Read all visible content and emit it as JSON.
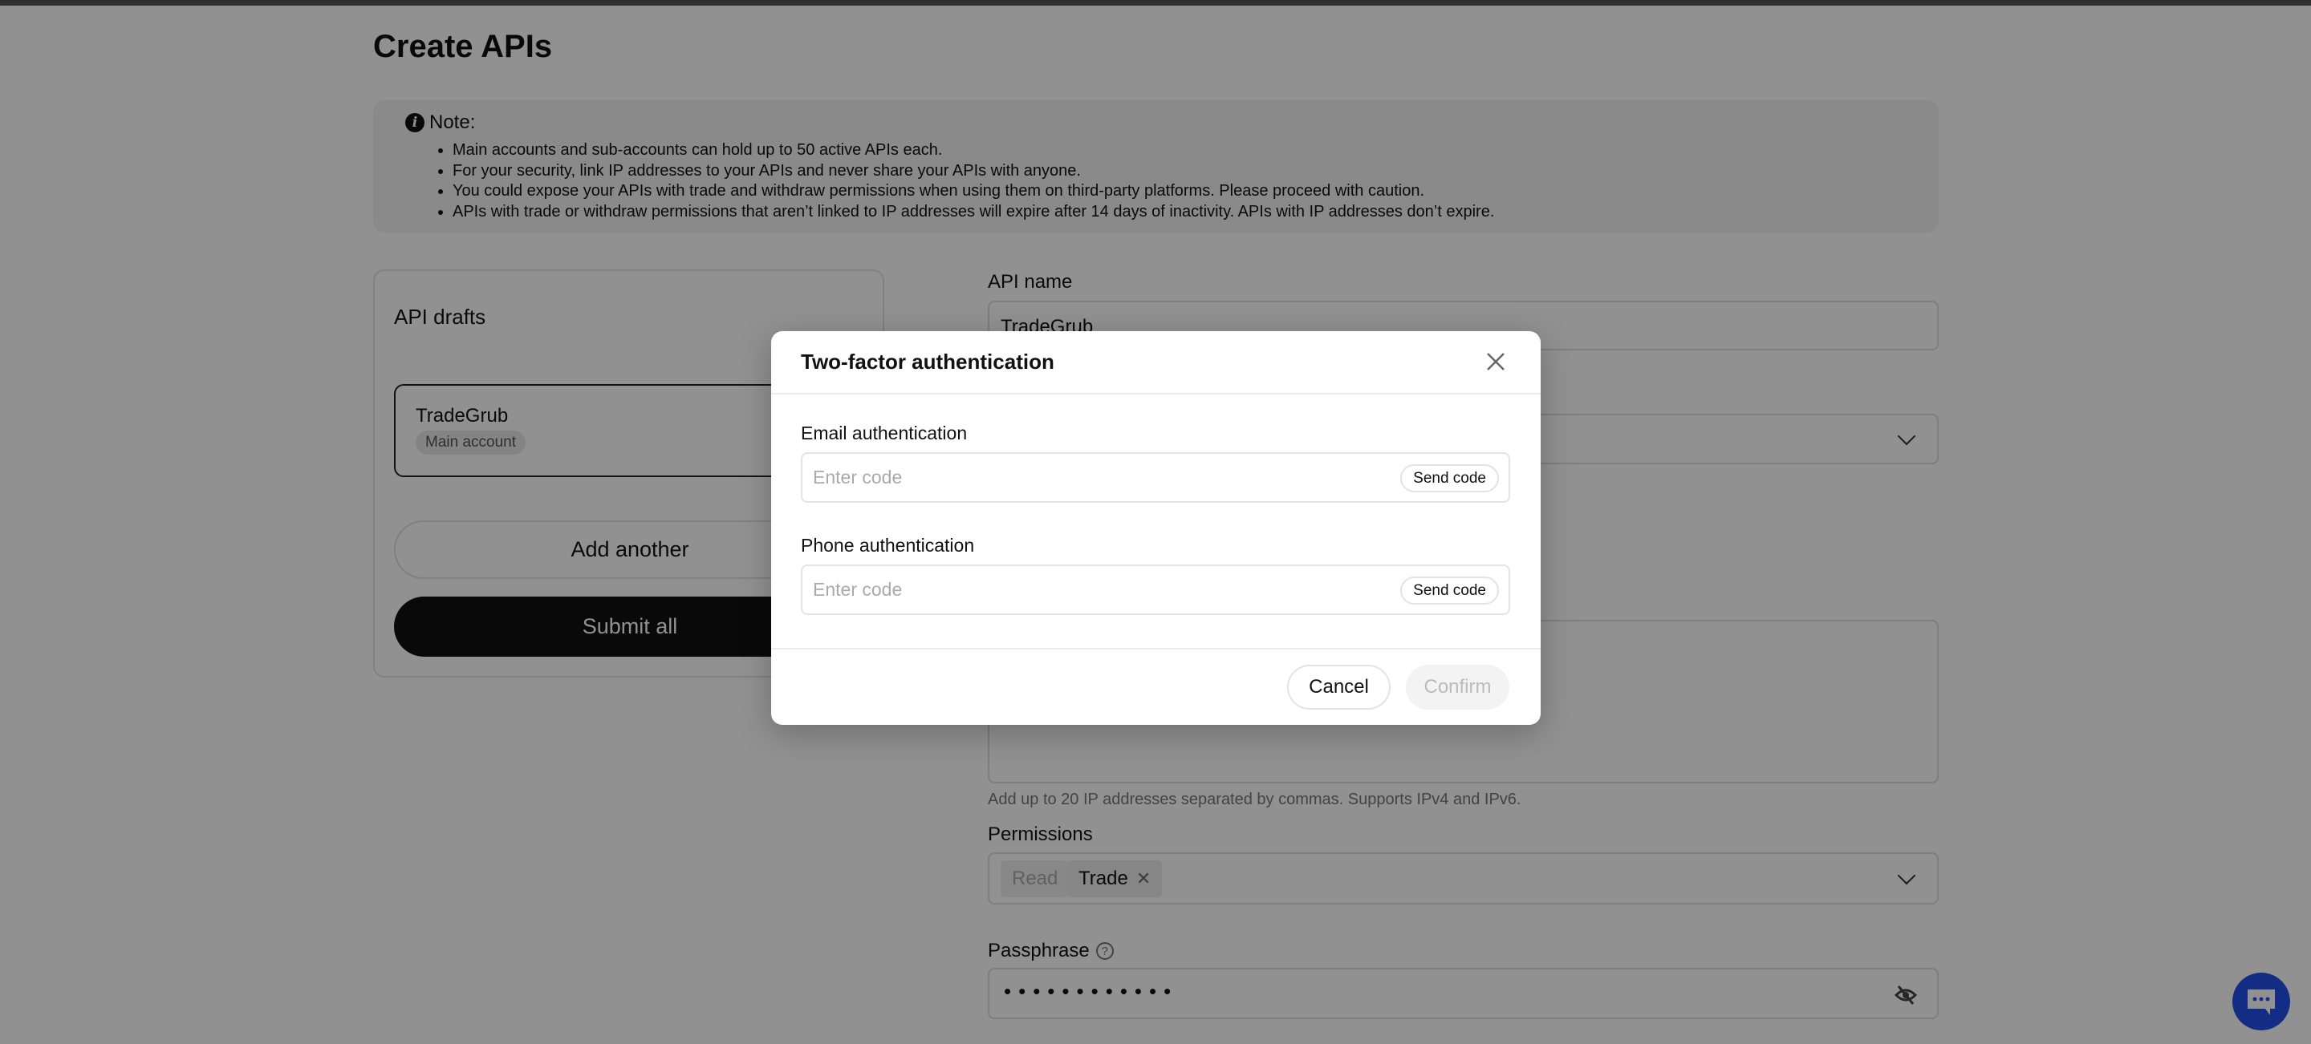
{
  "page": {
    "title": "Create APIs"
  },
  "note": {
    "title": "Note:",
    "items": [
      "Main accounts and sub-accounts can hold up to 50 active APIs each.",
      "For your security, link IP addresses to your APIs and never share your APIs with anyone.",
      "You could expose your APIs with trade and withdraw permissions when using them on third-party platforms. Please proceed with caution.",
      "APIs with trade or withdraw permissions that aren’t linked to IP addresses will expire after 14 days of inactivity. APIs with IP addresses don’t expire."
    ]
  },
  "drafts": {
    "title": "API drafts",
    "items": [
      {
        "name": "TradeGrub",
        "badge": "Main account"
      }
    ],
    "add_label": "Add another",
    "submit_label": "Submit all"
  },
  "form": {
    "api_name_label": "API name",
    "api_name_value": "TradeGrub",
    "ip_hint": "Add up to 20 IP addresses separated by commas. Supports IPv4 and IPv6.",
    "permissions_label": "Permissions",
    "permissions": [
      {
        "label": "Read",
        "disabled": true
      },
      {
        "label": "Trade",
        "removable": true
      }
    ],
    "passphrase_label": "Passphrase",
    "passphrase_value": "••••••••••••"
  },
  "modal": {
    "title": "Two-factor authentication",
    "email_label": "Email authentication",
    "email_placeholder": "Enter code",
    "phone_label": "Phone authentication",
    "phone_placeholder": "Enter code",
    "send_code": "Send code",
    "cancel": "Cancel",
    "confirm": "Confirm"
  },
  "colors": {
    "chat_button": "#2350ea",
    "primary_button": "#111111"
  }
}
